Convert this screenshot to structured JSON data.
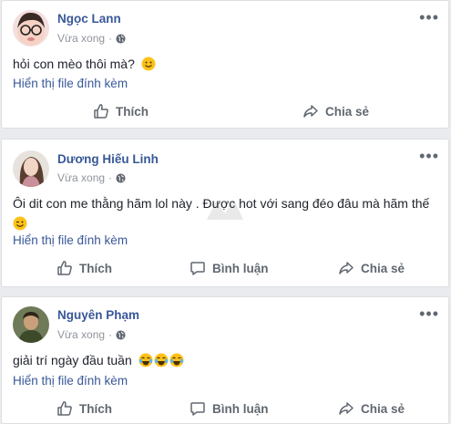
{
  "colors": {
    "link": "#385898",
    "text": "#1d2129",
    "meta": "#90949c",
    "action": "#606770",
    "bg": "#e9ebee"
  },
  "posts": [
    {
      "author": "Ngọc Lann",
      "time": "Vừa xong",
      "separator": "·",
      "privacy_icon": "globe-icon",
      "text": "hỏi con mèo thôi mà?",
      "emoji": [
        "smile-emoji"
      ],
      "attachment_link": "Hiển thị file đính kèm",
      "actions": [
        "Thích",
        "Chia sẻ"
      ]
    },
    {
      "author": "Dương Hiếu Linh",
      "time": "Vừa xong",
      "separator": "·",
      "privacy_icon": "globe-icon",
      "text": "Ôi dit con me thằng hãm lol này . Được hot với sang đéo đâu mà hãm thế",
      "emoji": [
        "wink-emoji"
      ],
      "attachment_link": "Hiển thị file đính kèm",
      "actions": [
        "Thích",
        "Bình luận",
        "Chia sẻ"
      ]
    },
    {
      "author": "Nguyên Phạm",
      "time": "Vừa xong",
      "separator": "·",
      "privacy_icon": "globe-icon",
      "text": "giải trí ngày đầu tuần",
      "emoji": [
        "tears-of-joy-emoji",
        "tears-of-joy-emoji",
        "tears-of-joy-emoji"
      ],
      "attachment_link": "Hiển thị file đính kèm",
      "actions": [
        "Thích",
        "Bình luận",
        "Chia sẻ"
      ]
    }
  ]
}
